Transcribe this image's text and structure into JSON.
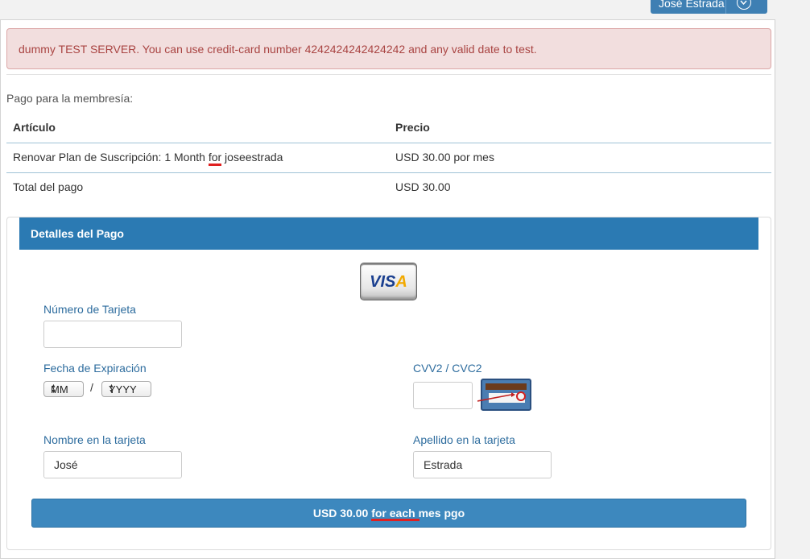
{
  "header": {
    "user_name": "José Estrada",
    "user_menu_icon": "chevron-down-circle-icon"
  },
  "alert": {
    "text": "dummy TEST SERVER. You can use credit-card number 4242424242424242 and any valid date to test."
  },
  "membership": {
    "subtitle": "Pago para la membresía:",
    "columns": [
      "Artículo",
      "Precio"
    ],
    "rows": [
      {
        "item_prefix": "Renovar Plan de Suscripción: 1 Month ",
        "item_highlight": "for",
        "item_suffix": " joseestrada",
        "price": "USD 30.00 por mes"
      },
      {
        "item": "Total del pago",
        "price": "USD 30.00"
      }
    ]
  },
  "payment": {
    "heading": "Detalles del Pago",
    "card_logo": {
      "text_blue": "VIS",
      "text_accent": "A",
      "accent_color": "#f2a900"
    },
    "card_number_label": "Número de Tarjeta",
    "card_number_value": "",
    "expiration_label": "Fecha de Expiración",
    "month_value": "MM",
    "year_value": "YYYY",
    "date_separator": "/",
    "cvv_label": "CVV2 / CVC2",
    "cvv_value": "",
    "first_name_label": "Nombre en la tarjeta",
    "first_name_value": "José",
    "last_name_label": "Apellido en la tarjeta",
    "last_name_value": "Estrada",
    "submit_label": "USD 30.00 for each mes pgo"
  },
  "colors": {
    "primary": "#2b7ab3",
    "alert_bg": "#f2dede",
    "alert_text": "#a94442",
    "label": "#2d6c9e",
    "annotation": "#e02020"
  }
}
